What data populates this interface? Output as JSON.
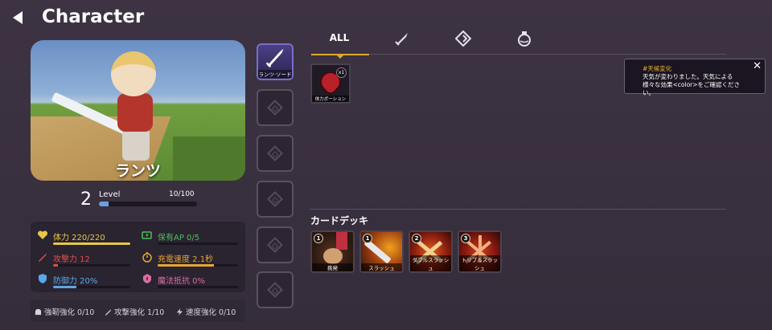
{
  "header": {
    "title": "Character"
  },
  "character": {
    "name": "ランツ",
    "level": "2",
    "level_label": "Level",
    "exp_text": "10/100",
    "exp_fraction": 0.1
  },
  "stats": [
    {
      "name": "体力",
      "text": "体力 220/220",
      "color": "#e6c84a",
      "fill": 1.0,
      "icon": "heart-icon"
    },
    {
      "name": "攻撃力",
      "text": "攻撃力 12",
      "color": "#e0504a",
      "fill": 0.06,
      "icon": "sword-icon"
    },
    {
      "name": "防御力",
      "text": "防御力 20%",
      "color": "#5aa8e6",
      "fill": 0.3,
      "icon": "shield-icon"
    },
    {
      "name": "保有AP",
      "text": "保有AP 0/5",
      "color": "#4cc05a",
      "fill": 0.0,
      "icon": "battery-icon"
    },
    {
      "name": "充電速度",
      "text": "充電速度 2.1秒",
      "color": "#e6a830",
      "fill": 0.7,
      "icon": "stopwatch-icon"
    },
    {
      "name": "魔法抵抗",
      "text": "魔法抵抗 0%",
      "color": "#d870a0",
      "fill": 0.0,
      "icon": "magic-shield-icon"
    }
  ],
  "enhancements": [
    {
      "text": "強靭強化 0/10",
      "icon": "helmet-icon"
    },
    {
      "text": "攻撃強化 1/10",
      "icon": "sword-icon"
    },
    {
      "text": "速度強化 0/10",
      "icon": "lightning-icon"
    }
  ],
  "equipment": {
    "equipped_label": "ランツ·ソード",
    "equipped_icon": "sword-icon",
    "empty_slot_icon": "empty-slot-icon"
  },
  "tabs": [
    {
      "label": "ALL",
      "active": true
    },
    {
      "label": "",
      "icon": "sword-icon"
    },
    {
      "label": "",
      "icon": "diamond-icon"
    },
    {
      "label": "",
      "icon": "potion-icon"
    }
  ],
  "inventory": [
    {
      "name": "体力ポーション",
      "count": "x1",
      "icon": "heart-potion-icon"
    }
  ],
  "tooltip": {
    "title": "#天候変化",
    "line1": "天気が変わりました。天気による",
    "line2": "様々な効果<color>をご確認ください。"
  },
  "deck": {
    "title": "カードデッキ",
    "cards": [
      {
        "cost": "1",
        "name": "挑発"
      },
      {
        "cost": "1",
        "name": "スラッシュ"
      },
      {
        "cost": "2",
        "name": "ダブルスラッシュ"
      },
      {
        "cost": "3",
        "name": "トリプルスラッシュ"
      }
    ]
  }
}
